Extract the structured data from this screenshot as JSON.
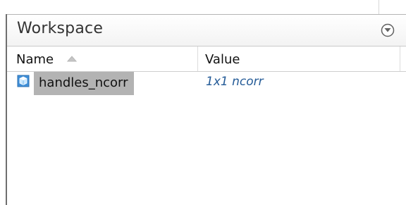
{
  "panel": {
    "title": "Workspace",
    "menu_icon": "circle-down-arrow-icon"
  },
  "table": {
    "columns": [
      {
        "label": "Name",
        "sort": "ascending-arrow-icon"
      },
      {
        "label": "Value"
      }
    ],
    "rows": [
      {
        "icon": "cube-object-icon",
        "name": "handles_ncorr",
        "value": "1x1 ncorr",
        "selected": true
      }
    ]
  },
  "colors": {
    "selection": "#b3b3b3",
    "value_text": "#245b97",
    "icon_blue": "#3f8fd8"
  }
}
